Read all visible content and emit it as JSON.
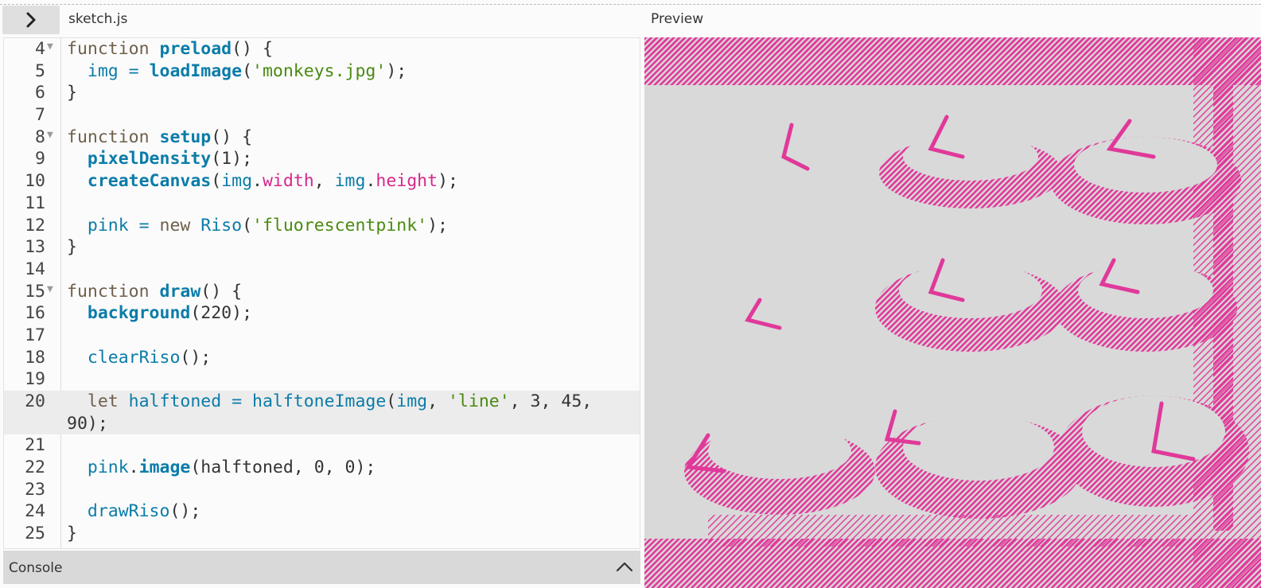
{
  "editor_tab": {
    "title": "sketch.js"
  },
  "preview_panel": {
    "title": "Preview"
  },
  "console": {
    "label": "Console"
  },
  "code_lines": [
    {
      "num": "4",
      "fold": true,
      "tokens": [
        [
          "kw",
          "function "
        ],
        [
          "fn",
          "preload"
        ],
        [
          "",
          "() {"
        ]
      ]
    },
    {
      "num": "5",
      "fold": false,
      "tokens": [
        [
          "",
          "  "
        ],
        [
          "call",
          "img"
        ],
        [
          "op",
          " = "
        ],
        [
          "fn",
          "loadImage"
        ],
        [
          "",
          "("
        ],
        [
          "str",
          "'monkeys.jpg'"
        ],
        [
          "",
          ");"
        ]
      ]
    },
    {
      "num": "6",
      "fold": false,
      "tokens": [
        [
          "",
          "}"
        ]
      ]
    },
    {
      "num": "7",
      "fold": false,
      "tokens": []
    },
    {
      "num": "8",
      "fold": true,
      "tokens": [
        [
          "kw",
          "function "
        ],
        [
          "fn",
          "setup"
        ],
        [
          "",
          "() {"
        ]
      ]
    },
    {
      "num": "9",
      "fold": false,
      "tokens": [
        [
          "",
          "  "
        ],
        [
          "fn",
          "pixelDensity"
        ],
        [
          "",
          "(1);"
        ]
      ]
    },
    {
      "num": "10",
      "fold": false,
      "tokens": [
        [
          "",
          "  "
        ],
        [
          "fn",
          "createCanvas"
        ],
        [
          "",
          "("
        ],
        [
          "call",
          "img"
        ],
        [
          "",
          "."
        ],
        [
          "prop",
          "width"
        ],
        [
          "",
          ", "
        ],
        [
          "call",
          "img"
        ],
        [
          "",
          "."
        ],
        [
          "prop",
          "height"
        ],
        [
          "",
          ");"
        ]
      ]
    },
    {
      "num": "11",
      "fold": false,
      "tokens": []
    },
    {
      "num": "12",
      "fold": false,
      "tokens": [
        [
          "",
          "  "
        ],
        [
          "call",
          "pink"
        ],
        [
          "op",
          " = "
        ],
        [
          "kw",
          "new "
        ],
        [
          "call",
          "Riso"
        ],
        [
          "",
          "("
        ],
        [
          "str",
          "'fluorescentpink'"
        ],
        [
          "",
          ");"
        ]
      ]
    },
    {
      "num": "13",
      "fold": false,
      "tokens": [
        [
          "",
          "}"
        ]
      ]
    },
    {
      "num": "14",
      "fold": false,
      "tokens": []
    },
    {
      "num": "15",
      "fold": true,
      "tokens": [
        [
          "kw",
          "function "
        ],
        [
          "fn",
          "draw"
        ],
        [
          "",
          "() {"
        ]
      ]
    },
    {
      "num": "16",
      "fold": false,
      "tokens": [
        [
          "",
          "  "
        ],
        [
          "fn",
          "background"
        ],
        [
          "",
          "(220);"
        ]
      ]
    },
    {
      "num": "17",
      "fold": false,
      "tokens": []
    },
    {
      "num": "18",
      "fold": false,
      "tokens": [
        [
          "",
          "  "
        ],
        [
          "call",
          "clearRiso"
        ],
        [
          "",
          "();"
        ]
      ]
    },
    {
      "num": "19",
      "fold": false,
      "tokens": []
    },
    {
      "num": "20",
      "fold": false,
      "active": true,
      "tall": true,
      "tokens": [
        [
          "",
          "  "
        ],
        [
          "kw",
          "let "
        ],
        [
          "call",
          "halftoned"
        ],
        [
          "op",
          " = "
        ],
        [
          "call",
          "halftoneImage"
        ],
        [
          "",
          "("
        ],
        [
          "call",
          "img"
        ],
        [
          "",
          ", "
        ],
        [
          "str",
          "'line'"
        ],
        [
          "",
          ", 3, 45, 90);"
        ]
      ]
    },
    {
      "num": "21",
      "fold": false,
      "tokens": []
    },
    {
      "num": "22",
      "fold": false,
      "tokens": [
        [
          "",
          "  "
        ],
        [
          "call",
          "pink"
        ],
        [
          "",
          "."
        ],
        [
          "fn",
          "image"
        ],
        [
          "",
          "(halftoned, 0, 0);"
        ]
      ]
    },
    {
      "num": "23",
      "fold": false,
      "tokens": []
    },
    {
      "num": "24",
      "fold": false,
      "tokens": [
        [
          "",
          "  "
        ],
        [
          "call",
          "drawRiso"
        ],
        [
          "",
          "();"
        ]
      ]
    },
    {
      "num": "25",
      "fold": false,
      "tokens": [
        [
          "",
          "}"
        ]
      ]
    }
  ],
  "colors": {
    "riso_pink": "#e0399a",
    "canvas_bg": "#d9d9d9",
    "keyword": "#6f5f4c",
    "function": "#0b7ca9",
    "string": "#4a8a10",
    "property": "#d52889"
  },
  "icons": {
    "toggle": "chevron-right-icon",
    "console_toggle": "chevron-up-icon",
    "fold": "fold-triangle-icon"
  }
}
